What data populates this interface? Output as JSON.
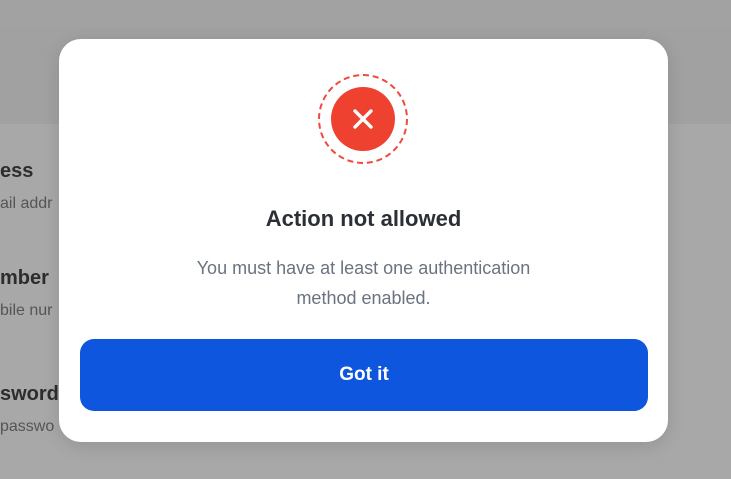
{
  "background": {
    "rows": [
      {
        "title": "ess",
        "subtitle": "ail addr"
      },
      {
        "title": "mber",
        "subtitle": "bile nur"
      },
      {
        "title": "sword",
        "subtitle": "passwo"
      }
    ]
  },
  "dialog": {
    "icon": "error-x-icon",
    "title": "Action not allowed",
    "message": "You must have at least one authentication method enabled.",
    "button_label": "Got it"
  },
  "colors": {
    "error": "#EE4130",
    "primary": "#0F56DF"
  }
}
